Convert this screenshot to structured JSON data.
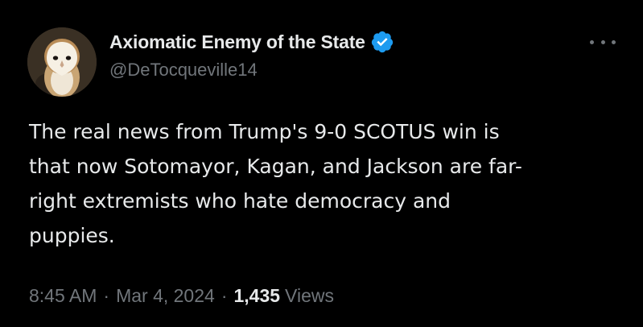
{
  "author": {
    "display_name": "Axiomatic Enemy of the State",
    "handle": "@DeTocqueville14",
    "verified": true,
    "avatar_icon": "barn-owl-avatar"
  },
  "tweet": {
    "lines": [
      "The real news from Trump's 9-0 SCOTUS win is",
      "that now Sotomayor, Kagan, and Jackson are far-",
      "right extremists who hate democracy and",
      "puppies."
    ],
    "time": "8:45 AM",
    "date": "Mar 4, 2024",
    "separator": "·",
    "views_count": "1,435",
    "views_label": "Views"
  },
  "icons": {
    "more": "more-options-icon",
    "verified": "verified-badge-icon"
  },
  "colors": {
    "background": "#000000",
    "primary_text": "#e7e9ea",
    "secondary_text": "#71767b",
    "verified_blue": "#1d9bf0"
  }
}
